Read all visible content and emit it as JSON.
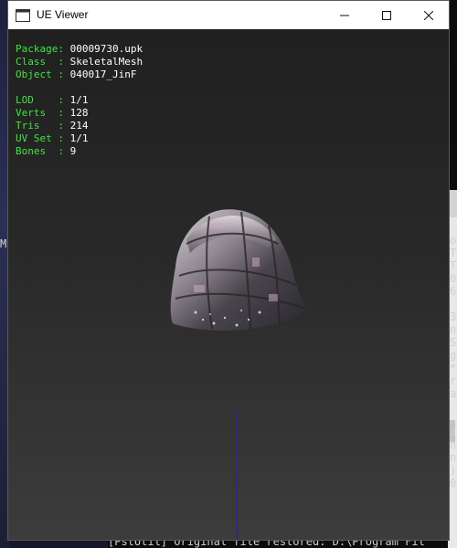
{
  "window": {
    "title": "UE Viewer",
    "controls": {
      "minimize": "—",
      "maximize": "☐",
      "close": "✕"
    }
  },
  "info": {
    "rows": [
      {
        "label": "Package",
        "value": "00009730.upk"
      },
      {
        "label": "Class  ",
        "value": "SkeletalMesh"
      },
      {
        "label": "Object ",
        "value": "040017_JinF"
      }
    ],
    "stats": [
      {
        "label": "LOD    ",
        "value": "1/1"
      },
      {
        "label": "Verts  ",
        "value": "128"
      },
      {
        "label": "Tris   ",
        "value": "214"
      },
      {
        "label": "UV Set ",
        "value": "1/1"
      },
      {
        "label": "Bones  ",
        "value": "9"
      }
    ],
    "label_color": "#3fe63f",
    "value_color": "#ffffff"
  },
  "console": {
    "right_chars": [
      "o",
      "T",
      "T",
      "0",
      "6",
      "",
      "3",
      "n",
      "S",
      "g",
      "*",
      "r",
      "a",
      "",
      ".",
      "J",
      "n",
      "n",
      ")",
      "0"
    ],
    "bottom_text": "[PstUtil] Original file restored: D:\\Program Fil",
    "left_char": "M"
  }
}
